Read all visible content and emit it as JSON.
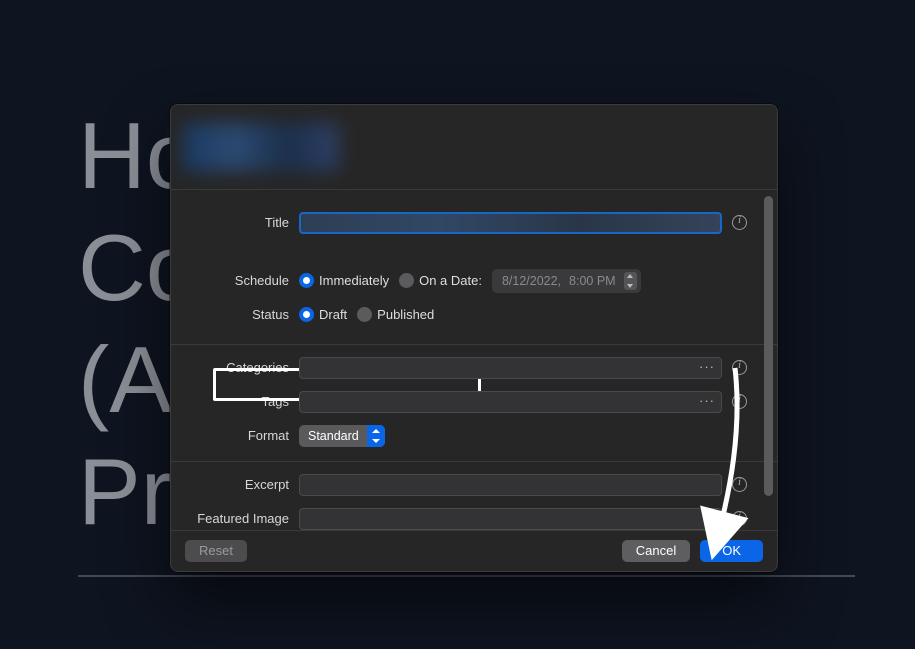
{
  "background_text": "Ho\nCo                  ss\n(A\nPr",
  "dialog": {
    "title_label": "Title",
    "title_value": "",
    "schedule": {
      "label": "Schedule",
      "opt_immediately": "Immediately",
      "opt_on_date": "On a Date:",
      "selected": "immediately",
      "date": "8/12/2022,",
      "time": "8:00 PM"
    },
    "status": {
      "label": "Status",
      "opt_draft": "Draft",
      "opt_published": "Published",
      "selected": "draft"
    },
    "categories_label": "Categories",
    "tags_label": "Tags",
    "format": {
      "label": "Format",
      "value": "Standard"
    },
    "excerpt_label": "Excerpt",
    "featured_image_label": "Featured Image",
    "buttons": {
      "reset": "Reset",
      "cancel": "Cancel",
      "ok": "OK"
    }
  }
}
